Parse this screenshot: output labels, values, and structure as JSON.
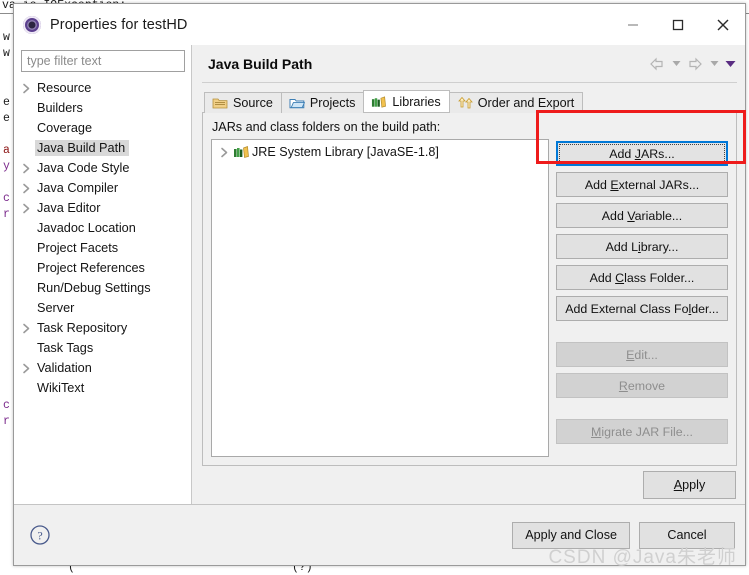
{
  "background": {
    "lines": [
      "va.io.IOException:",
      "w",
      "w",
      "",
      "e",
      "e",
      "",
      "a",
      "y",
      "",
      "c",
      "r",
      "",
      "",
      "",
      "",
      "",
      "",
      "",
      "",
      "",
      "",
      "",
      "",
      "c",
      "r",
      "",
      "",
      "",
      "",
      "",
      "",
      "",
      "",
      "(",
      "(?)"
    ]
  },
  "dialog": {
    "title": "Properties for testHD",
    "icon": "properties-gear-icon",
    "window_controls": [
      {
        "name": "minimize-button",
        "glyph": "minimize-icon"
      },
      {
        "name": "maximize-button",
        "glyph": "maximize-icon"
      },
      {
        "name": "close-button",
        "glyph": "close-icon"
      }
    ]
  },
  "sidebar": {
    "filter": {
      "placeholder": "type filter text",
      "value": ""
    },
    "items": [
      {
        "label": "Resource",
        "expandable": true,
        "selected": false
      },
      {
        "label": "Builders",
        "expandable": false,
        "selected": false
      },
      {
        "label": "Coverage",
        "expandable": false,
        "selected": false
      },
      {
        "label": "Java Build Path",
        "expandable": false,
        "selected": true
      },
      {
        "label": "Java Code Style",
        "expandable": true,
        "selected": false
      },
      {
        "label": "Java Compiler",
        "expandable": true,
        "selected": false
      },
      {
        "label": "Java Editor",
        "expandable": true,
        "selected": false
      },
      {
        "label": "Javadoc Location",
        "expandable": false,
        "selected": false
      },
      {
        "label": "Project Facets",
        "expandable": false,
        "selected": false
      },
      {
        "label": "Project References",
        "expandable": false,
        "selected": false
      },
      {
        "label": "Run/Debug Settings",
        "expandable": false,
        "selected": false
      },
      {
        "label": "Server",
        "expandable": false,
        "selected": false
      },
      {
        "label": "Task Repository",
        "expandable": true,
        "selected": false
      },
      {
        "label": "Task Tags",
        "expandable": false,
        "selected": false
      },
      {
        "label": "Validation",
        "expandable": true,
        "selected": false
      },
      {
        "label": "WikiText",
        "expandable": false,
        "selected": false
      }
    ]
  },
  "page": {
    "title": "Java Build Path",
    "nav": {
      "back": "back-arrow-icon",
      "back_menu": "chevron-down-icon",
      "forward": "forward-arrow-icon",
      "forward_menu": "chevron-down-icon",
      "view_menu": "view-menu-triangle-icon"
    },
    "tabs": [
      {
        "label": "Source",
        "icon": "source-folder-icon",
        "active": false
      },
      {
        "label": "Projects",
        "icon": "projects-folder-icon",
        "active": false
      },
      {
        "label": "Libraries",
        "icon": "libraries-books-icon",
        "active": true
      },
      {
        "label": "Order and Export",
        "icon": "order-export-icon",
        "active": false
      }
    ],
    "jars_label": "JARs and class folders on the build path:",
    "jar_entries": [
      {
        "label": "JRE System Library [JavaSE-1.8]",
        "icon": "library-books-icon",
        "expandable": true
      }
    ],
    "buttons": [
      {
        "label": "Add JARs...",
        "state": "focused",
        "name": "add-jars-button"
      },
      {
        "label": "Add External JARs...",
        "state": "enabled",
        "name": "add-external-jars-button"
      },
      {
        "label": "Add Variable...",
        "state": "enabled",
        "name": "add-variable-button"
      },
      {
        "label": "Add Library...",
        "state": "enabled",
        "name": "add-library-button"
      },
      {
        "label": "Add Class Folder...",
        "state": "enabled",
        "name": "add-class-folder-button"
      },
      {
        "label": "Add External Class Folder...",
        "state": "enabled",
        "name": "add-external-class-folder-button"
      },
      {
        "label": "Edit...",
        "state": "disabled",
        "name": "edit-button"
      },
      {
        "label": "Remove",
        "state": "disabled",
        "name": "remove-button"
      },
      {
        "label": "Migrate JAR File...",
        "state": "disabled",
        "name": "migrate-jar-file-button"
      }
    ],
    "apply_label": "Apply"
  },
  "footer": {
    "help_icon": "help-question-icon",
    "apply_and_close_label": "Apply and Close",
    "cancel_label": "Cancel"
  },
  "annotation": {
    "highlight_color": "#ee1b1b",
    "target": "add-jars-button"
  },
  "watermark": {
    "text": "CSDN @Java朱老师"
  },
  "colors": {
    "accent_focus": "#0078d7",
    "dialog_bg": "#f0f0f0",
    "selection_bg": "#d8d8d8",
    "highlight": "#ee1b1b"
  }
}
